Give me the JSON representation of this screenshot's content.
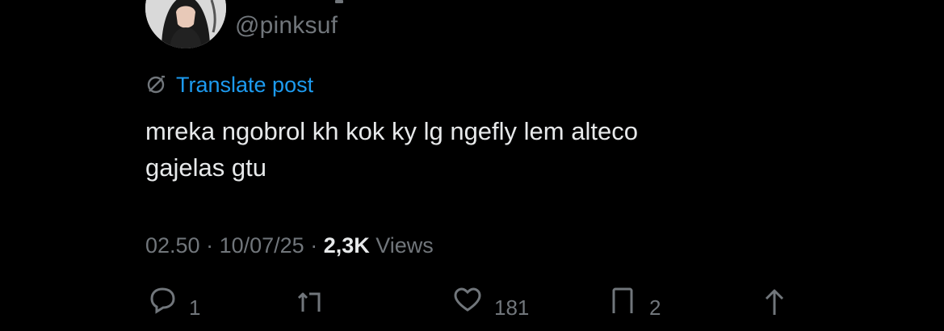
{
  "user": {
    "handle": "@pinksuf"
  },
  "translate": {
    "label": "Translate post"
  },
  "post": {
    "text": "mreka ngobrol kh kok ky lg ngefly lem alteco\ngajelas gtu"
  },
  "meta": {
    "time": "02.50",
    "separator_1": " · ",
    "date": "10/07/25",
    "separator_2": " · ",
    "views_count": "2,3K",
    "views_label": " Views"
  },
  "actions": {
    "reply_count": "1",
    "like_count": "181",
    "bookmark_count": "2"
  },
  "colors": {
    "background": "#000000",
    "text": "#e7e9ea",
    "secondary": "#71767b",
    "accent": "#1d9bf0"
  },
  "icons": [
    "avatar-photo",
    "translate-globe-icon",
    "reply-icon",
    "repost-icon",
    "like-icon",
    "bookmark-icon",
    "share-icon"
  ]
}
